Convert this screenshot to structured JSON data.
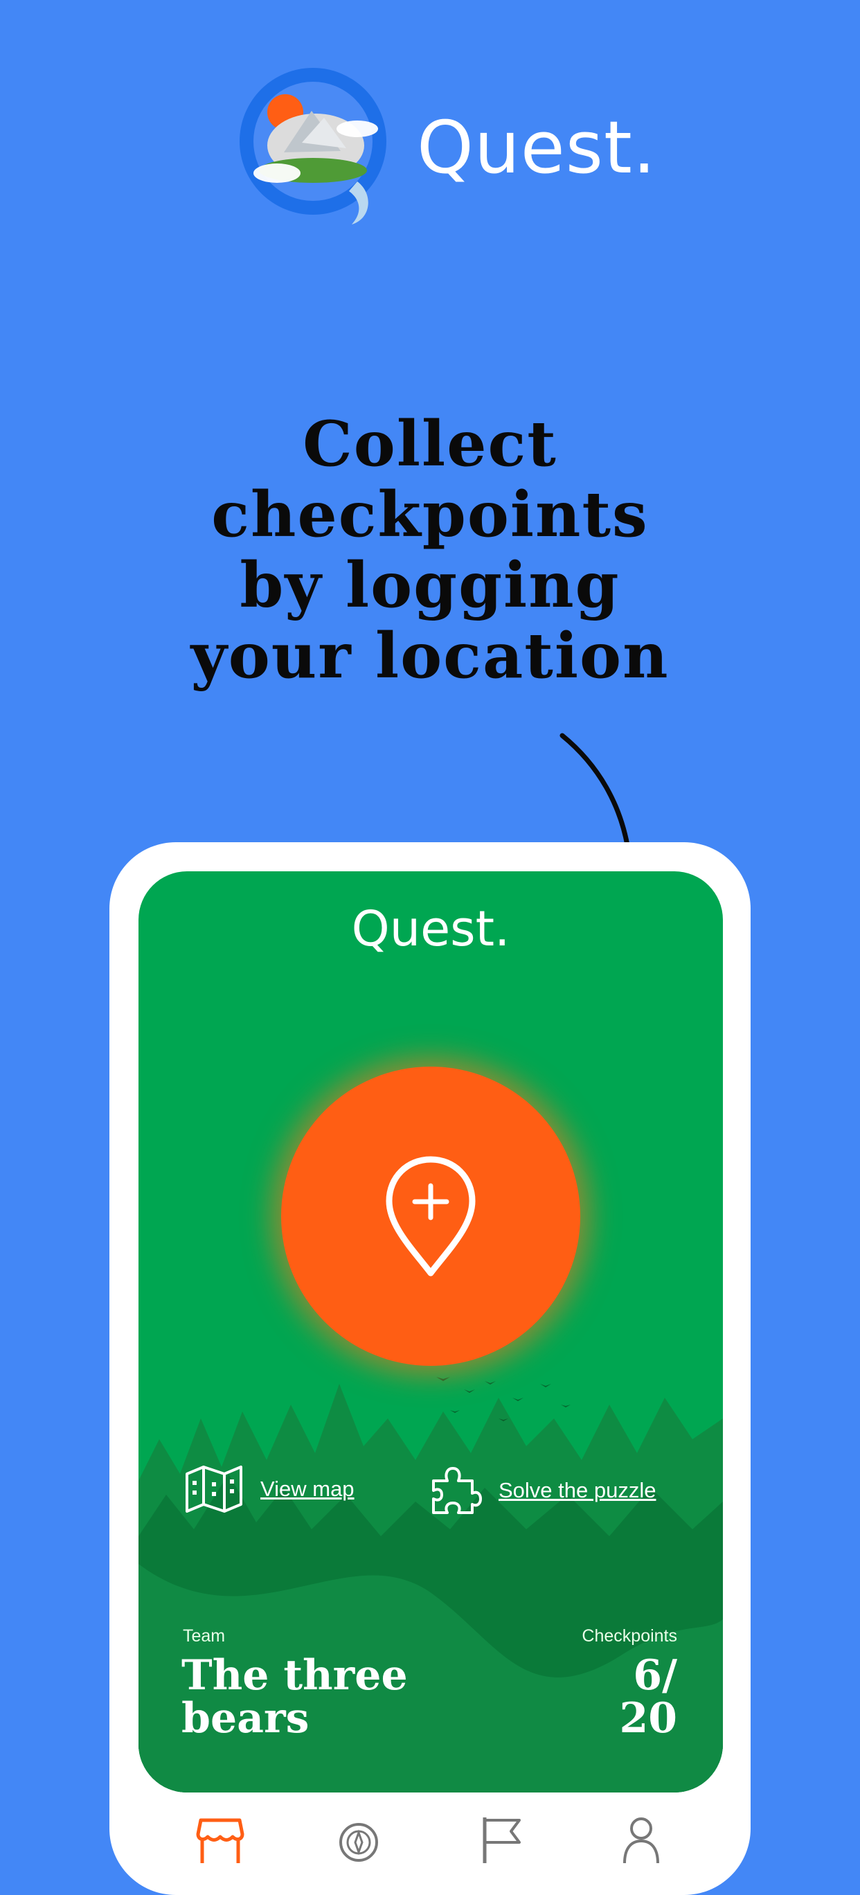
{
  "brand": {
    "name": "Quest.",
    "logo_icon": "globe-island-logo-icon"
  },
  "headline": [
    "Collect",
    "checkpoints",
    "by logging",
    "your location"
  ],
  "app": {
    "title": "Quest.",
    "checkin_icon": "location-pin-plus-icon",
    "actions": [
      {
        "label": "View map",
        "icon": "map-icon"
      },
      {
        "label": "Solve the puzzle",
        "icon": "puzzle-icon"
      }
    ],
    "team": {
      "label": "Team",
      "name_line1": "The three",
      "name_line2": "bears"
    },
    "checkpoints": {
      "label": "Checkpoints",
      "line1": "6/",
      "line2": "20",
      "collected": 6,
      "total": 20
    },
    "nav": [
      {
        "icon": "store-icon",
        "active": true
      },
      {
        "icon": "compass-icon",
        "active": false
      },
      {
        "icon": "flag-icon",
        "active": false
      },
      {
        "icon": "profile-icon",
        "active": false
      }
    ]
  },
  "colors": {
    "background": "#4387F6",
    "app_green": "#00A651",
    "accent_orange": "#FF5E14",
    "forest": "#0B8A3F"
  }
}
